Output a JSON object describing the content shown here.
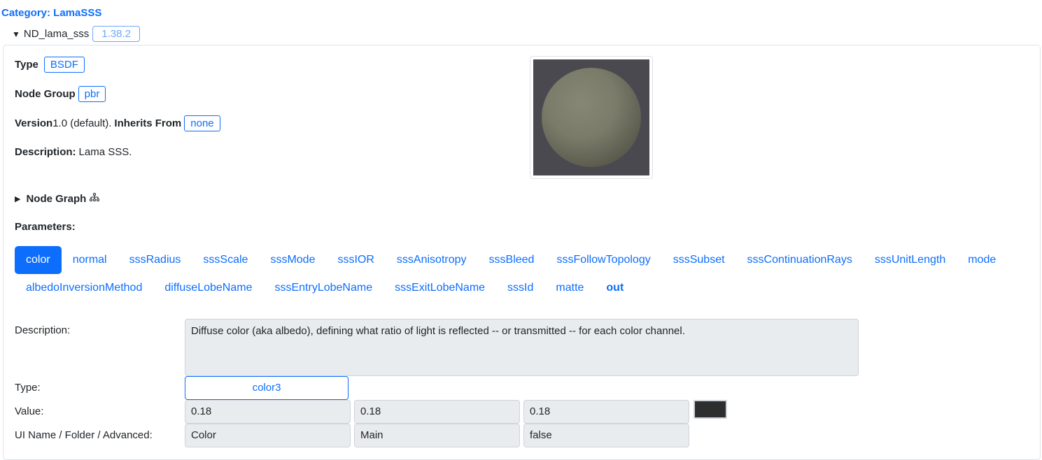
{
  "category": "Category: LamaSSS",
  "node": {
    "name": "ND_lama_sss",
    "version": "1.38.2",
    "caret": "▼"
  },
  "props": {
    "type_label": "Type",
    "type_value": "BSDF",
    "group_label": "Node Group",
    "group_value": "pbr",
    "version_label": "Version",
    "version_value": "1.0 (default).",
    "inherits_label": "Inherits From",
    "inherits_value": "none",
    "description_label": "Description:",
    "description_value": "Lama SSS."
  },
  "node_graph": {
    "label": "Node Graph",
    "caret": "▶"
  },
  "parameters_label": "Parameters:",
  "tabs": [
    {
      "label": "color"
    },
    {
      "label": "normal"
    },
    {
      "label": "sssRadius"
    },
    {
      "label": "sssScale"
    },
    {
      "label": "sssMode"
    },
    {
      "label": "sssIOR"
    },
    {
      "label": "sssAnisotropy"
    },
    {
      "label": "sssBleed"
    },
    {
      "label": "sssFollowTopology"
    },
    {
      "label": "sssSubset"
    },
    {
      "label": "sssContinuationRays"
    },
    {
      "label": "sssUnitLength"
    },
    {
      "label": "mode"
    },
    {
      "label": "albedoInversionMethod"
    },
    {
      "label": "diffuseLobeName"
    },
    {
      "label": "sssEntryLobeName"
    },
    {
      "label": "sssExitLobeName"
    },
    {
      "label": "sssId"
    },
    {
      "label": "matte"
    },
    {
      "label": "out"
    }
  ],
  "detail": {
    "description_label": "Description:",
    "description_text": "Diffuse color (aka albedo), defining what ratio of light is reflected -- or transmitted -- for each color channel.",
    "type_label": "Type:",
    "type_value": "color3",
    "value_label": "Value:",
    "values": [
      "0.18",
      "0.18",
      "0.18"
    ],
    "ui_label": "UI Name / Folder / Advanced:",
    "ui_values": [
      "Color",
      "Main",
      "false"
    ]
  },
  "colors": {
    "accent": "#0d6efd",
    "swatch": "#2e2e2e",
    "preview_bg": "#4a4950"
  }
}
